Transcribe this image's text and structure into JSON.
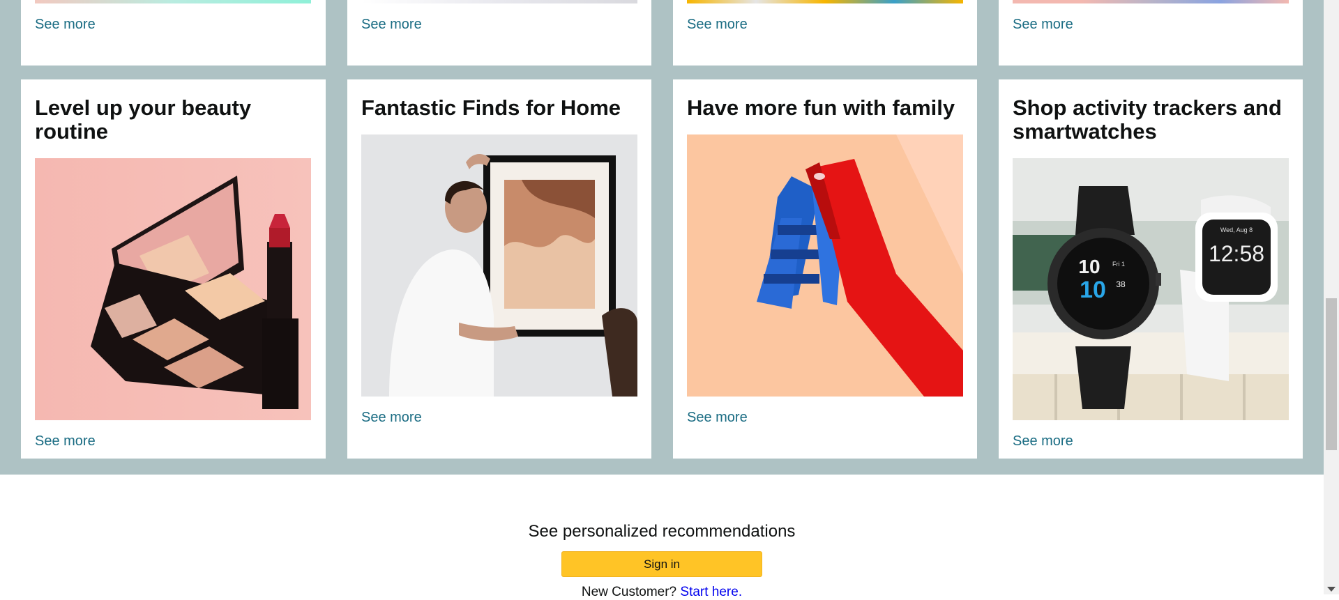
{
  "top_row": [
    {
      "see_more": "See more"
    },
    {
      "see_more": "See more"
    },
    {
      "see_more": "See more"
    },
    {
      "see_more": "See more"
    }
  ],
  "cards": [
    {
      "title": "Level up your beauty routine",
      "image": "makeup-palette-lipstick-image",
      "see_more": "See more"
    },
    {
      "title": "Fantastic Finds for Home",
      "image": "man-hanging-framed-art-image",
      "see_more": "See more"
    },
    {
      "title": "Have more fun with family",
      "image": "kids-slide-image",
      "see_more": "See more"
    },
    {
      "title": "Shop activity trackers and smartwatches",
      "image": "smartwatches-image",
      "see_more": "See more"
    }
  ],
  "watch_faces": {
    "left_hour": "10",
    "left_min": "10",
    "left_sec": "38",
    "left_label": "Fri 1",
    "right_time": "12:58",
    "right_date": "Wed, Aug 8"
  },
  "signin": {
    "recommendations_text": "See personalized recommendations",
    "button_label": "Sign in",
    "new_customer_text": "New Customer?",
    "start_here_link": "Start here."
  },
  "colors": {
    "background_band": "#aec2c4",
    "link": "#1a6c83",
    "signin_button": "#ffc426"
  }
}
